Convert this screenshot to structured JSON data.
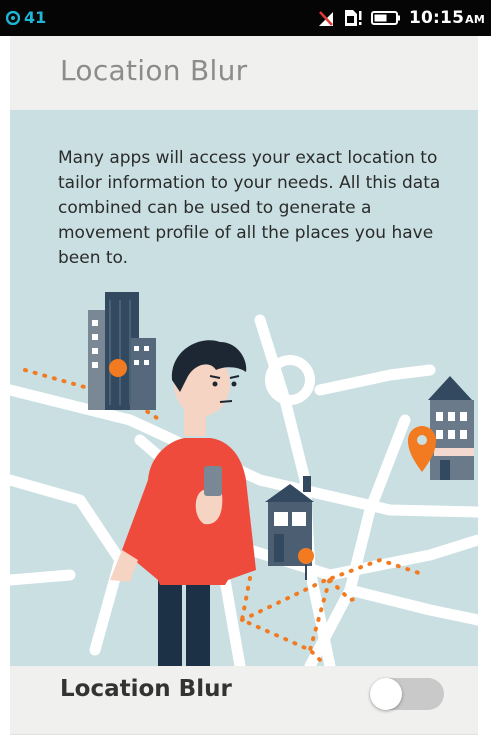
{
  "status_bar": {
    "notification_count": "41",
    "time": "10:15",
    "ampm": "AM",
    "icons": [
      "notification-badge-icon",
      "no-signal-icon",
      "sim-alert-icon",
      "battery-icon"
    ]
  },
  "header": {
    "title": "Location Blur"
  },
  "intro": {
    "description": "Many apps will access your exact location to tailor information to your needs. All this data combined can be used to generate a movement profile of all the places you have been to."
  },
  "setting": {
    "label": "Location Blur",
    "enabled": false
  },
  "colors": {
    "panel_bg": "#c9dfe2",
    "accent_orange": "#f27b21",
    "shirt_red": "#ef4b3d",
    "toggle_off": "#c9c9c9"
  }
}
